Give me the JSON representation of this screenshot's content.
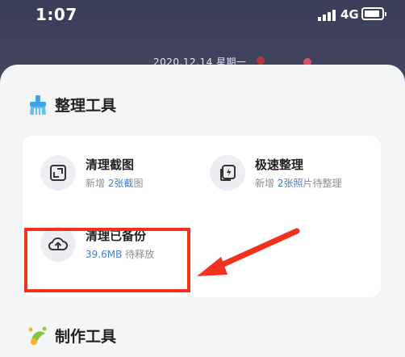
{
  "status_bar": {
    "time": "1:07",
    "network": "4G"
  },
  "background": {
    "date_text": "2020.12.14  星期一"
  },
  "sections": {
    "tools_title": "整理工具",
    "make_title": "制作工具"
  },
  "tools": [
    {
      "name": "清理截图",
      "sub_prefix": "新增 ",
      "sub_highlight": "2张截",
      "sub_suffix": "图",
      "icon": "crop-icon"
    },
    {
      "name": "极速整理",
      "sub_prefix": "新增 ",
      "sub_highlight": "2张照",
      "sub_suffix": "片待整理",
      "icon": "flash-photo-icon"
    },
    {
      "name": "清理已备份",
      "sub_prefix": "",
      "sub_highlight": "39.6MB",
      "sub_suffix": " 待释放",
      "icon": "cloud-upload-icon"
    }
  ],
  "colors": {
    "accent": "#3d7fd9",
    "annotation": "#f2311f",
    "sheet": "#f4f5f7"
  }
}
